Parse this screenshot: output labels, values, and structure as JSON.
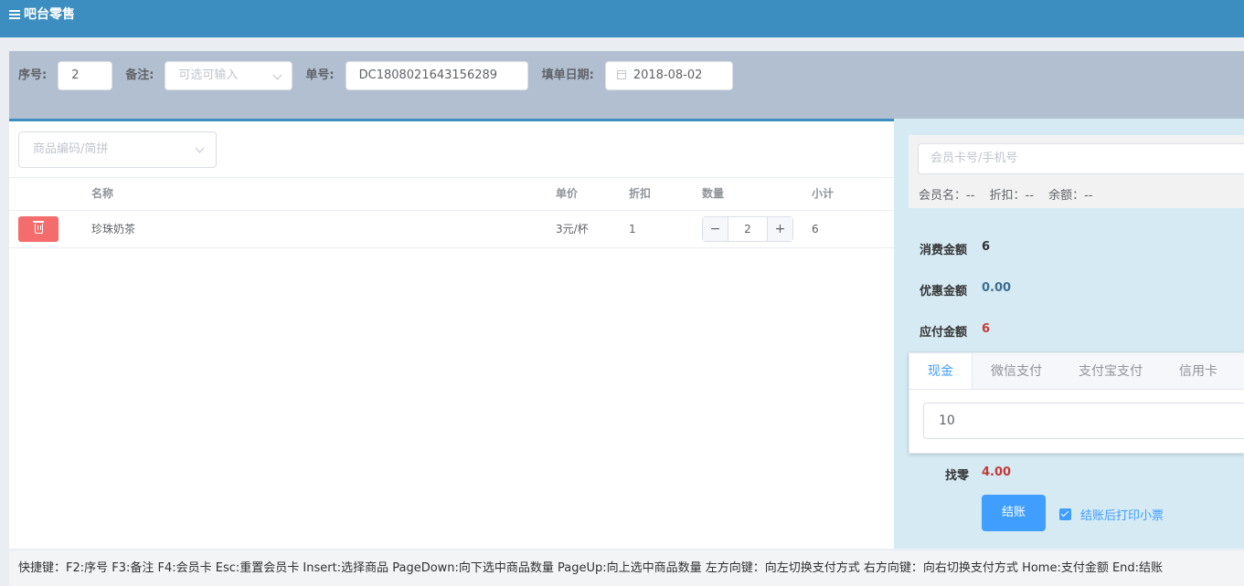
{
  "header": {
    "title": "吧台零售",
    "menu_icon": "menu-icon"
  },
  "form": {
    "seq_label": "序号:",
    "seq_value": "2",
    "remark_label": "备注:",
    "remark_placeholder": "可选可输入",
    "order_label": "单号:",
    "order_value": "DC1808021643156289",
    "date_label": "填单日期:",
    "date_value": "2018-08-02"
  },
  "products": {
    "search_placeholder": "商品编码/简拼",
    "columns": [
      "名称",
      "单价",
      "折扣",
      "数量",
      "小计"
    ],
    "rows": [
      {
        "name": "珍珠奶茶",
        "price": "3元/杯",
        "discount": "1",
        "qty": "2",
        "subtotal": "6"
      }
    ]
  },
  "member": {
    "placeholder": "会员卡号/手机号",
    "name": "会员名：--",
    "discount": "折扣：--",
    "balance": "余额：--"
  },
  "amounts": {
    "consume_label": "消费金额",
    "consume_value": "6",
    "discount_label": "优惠金额",
    "discount_value": "0.00",
    "payable_label": "应付金额",
    "payable_value": "6"
  },
  "payment": {
    "tabs": [
      "现金",
      "微信支付",
      "支付宝支付",
      "信用卡"
    ],
    "active_tab": 0,
    "cash_value": "10"
  },
  "change": {
    "label": "找零",
    "value": "4.00"
  },
  "checkout": {
    "button_label": "结账",
    "print_label": "结账后打印小票",
    "print_checked": true
  },
  "footer": {
    "shortcuts": "快捷键：F2:序号 F3:备注 F4:会员卡 Esc:重置会员卡 Insert:选择商品 PageDown:向下选中商品数量 PageUp:向上选中商品数量 左方向键：向左切换支付方式 右方向键：向右切换支付方式 Home:支付金额 End:结账"
  },
  "colors": {
    "header_bg": "#3b8ebf",
    "primary": "#409eff",
    "danger": "#f56c6c",
    "amount_red": "#c33a3a"
  }
}
